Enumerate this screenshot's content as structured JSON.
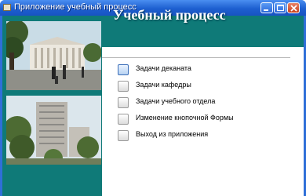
{
  "window": {
    "title": "Приложение учебный процесс"
  },
  "banner": {
    "title": "Учебный процесс"
  },
  "menu": {
    "items": [
      {
        "label": "Задачи деканата",
        "icon": "checkbox-icon"
      },
      {
        "label": "Задачи кафедры",
        "icon": "checkbox-icon"
      },
      {
        "label": "Задачи учебного отдела",
        "icon": "checkbox-icon"
      },
      {
        "label": "Изменение кнопочной Формы",
        "icon": "checkbox-icon"
      },
      {
        "label": "Выход из приложения",
        "icon": "checkbox-icon"
      }
    ]
  },
  "colors": {
    "accent": "#0f7a78",
    "titlebar": "#1d5fd0",
    "background": "#ffffff"
  }
}
